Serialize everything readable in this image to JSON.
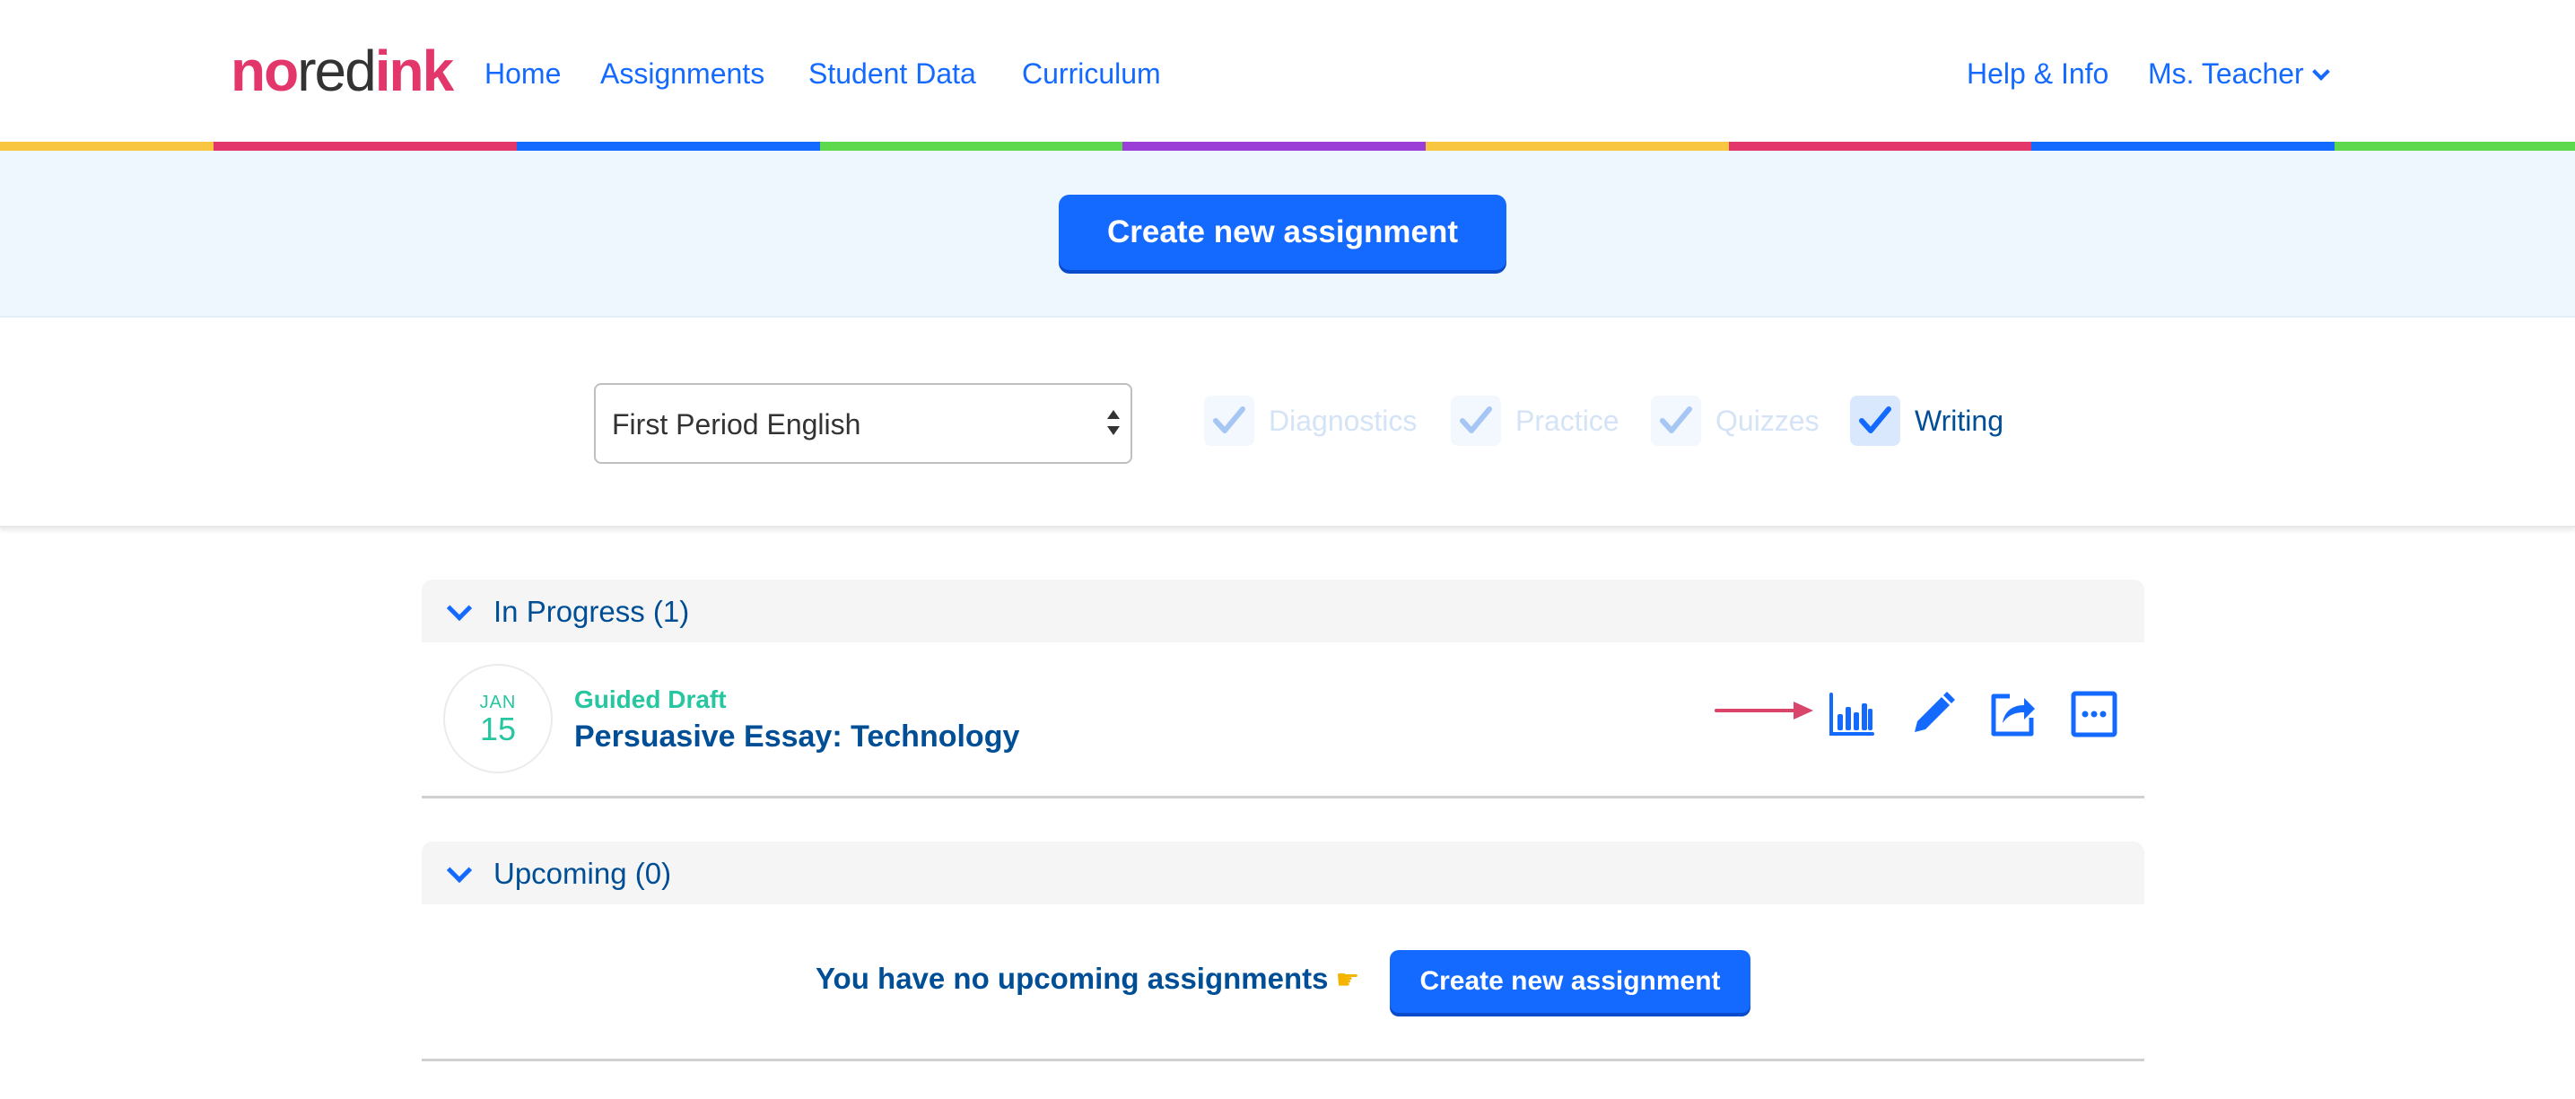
{
  "nav": {
    "logo": {
      "part1": "no",
      "part2": "red",
      "part3": "ink"
    },
    "links": [
      "Home",
      "Assignments",
      "Student Data",
      "Curriculum"
    ],
    "help": "Help & Info",
    "user": "Ms. Teacher"
  },
  "rainbow_colors": [
    "#f9c642",
    "#e3376b",
    "#146aff",
    "#5ed84c",
    "#9b3ed8",
    "#f9c642",
    "#e3376b",
    "#146aff",
    "#5ed84c"
  ],
  "hero": {
    "create_label": "Create new assignment"
  },
  "filters": {
    "class_select": "First Period English",
    "types": [
      {
        "label": "Diagnostics",
        "checked": false
      },
      {
        "label": "Practice",
        "checked": false
      },
      {
        "label": "Quizzes",
        "checked": false
      },
      {
        "label": "Writing",
        "checked": true
      }
    ]
  },
  "in_progress": {
    "title": "In Progress (1)",
    "assignment": {
      "month": "JAN",
      "day": "15",
      "type": "Guided Draft",
      "name": "Persuasive Essay: Technology",
      "actions": [
        "bar-chart-icon",
        "pencil-icon",
        "share-icon",
        "more-icon"
      ]
    }
  },
  "upcoming": {
    "title": "Upcoming (0)",
    "empty_message": "You have no upcoming assignments",
    "create_label": "Create new assignment"
  },
  "colors": {
    "primary": "#146aff",
    "navy": "#004e95",
    "green": "#26c6a0",
    "brand": "#e3376b",
    "arrow": "#d9456b"
  }
}
